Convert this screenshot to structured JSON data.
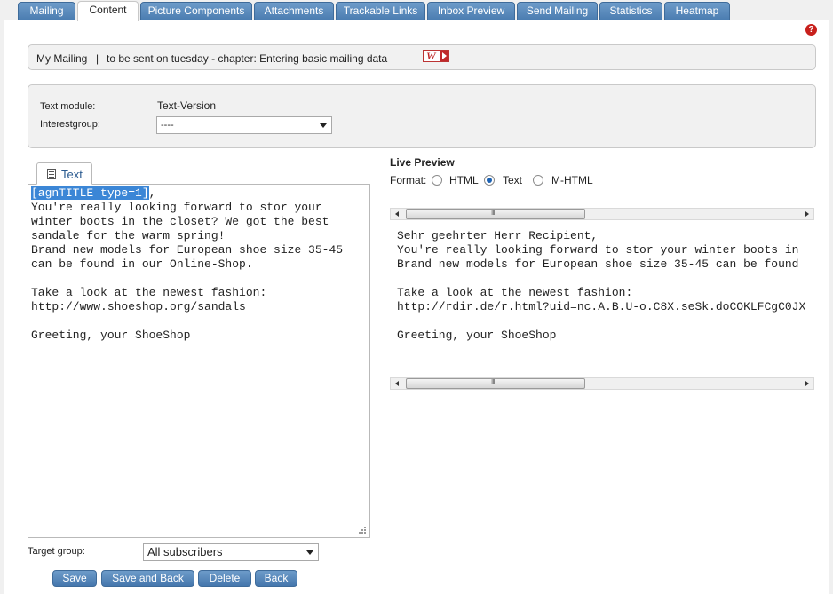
{
  "tabs": [
    {
      "label": "Mailing"
    },
    {
      "label": "Content"
    },
    {
      "label": "Picture Components"
    },
    {
      "label": "Attachments"
    },
    {
      "label": "Trackable Links"
    },
    {
      "label": "Inbox Preview"
    },
    {
      "label": "Send Mailing"
    },
    {
      "label": "Statistics"
    },
    {
      "label": "Heatmap"
    }
  ],
  "active_tab": "Content",
  "breadcrumb": {
    "mailing_name": "My Mailing",
    "separator": "|",
    "description": "to be sent on tuesday - chapter: Entering basic mailing data",
    "wiki_icon": "wiki-link-icon"
  },
  "help_icon": "help-icon",
  "module": {
    "text_module_label": "Text module:",
    "text_module_value": "Text-Version",
    "interestgroup_label": "Interestgroup:",
    "interestgroup_value": "----"
  },
  "editor": {
    "tab_label": "Text",
    "selected_token": "[agnTITLE type=1]",
    "content_rest": ",\nYou're really looking forward to stor your\nwinter boots in the closet? We got the best\nsandale for the warm spring!\nBrand new models for European shoe size 35-45\ncan be found in our Online-Shop.\n\nTake a look at the newest fashion:\nhttp://www.shoeshop.org/sandals\n\nGreeting, your ShoeShop"
  },
  "live_preview": {
    "title": "Live Preview",
    "format_label": "Format:",
    "formats": [
      "HTML",
      "Text",
      "M-HTML"
    ],
    "selected_format": "Text",
    "content": "Sehr geehrter Herr Recipient,\nYou're really looking forward to stor your winter boots in\nBrand new models for European shoe size 35-45 can be found\n\nTake a look at the newest fashion:\nhttp://rdir.de/r.html?uid=nc.A.B.U-o.C8X.seSk.doCOKLFCgC0JX\n\nGreeting, your ShoeShop"
  },
  "target_group": {
    "label": "Target group:",
    "value": "All subscribers"
  },
  "buttons": {
    "save": "Save",
    "save_and_back": "Save and Back",
    "delete": "Delete",
    "back": "Back"
  },
  "colors": {
    "tab_blue": "#4a7cb0",
    "selection_blue": "#3b86d6",
    "help_red": "#c8201c"
  }
}
